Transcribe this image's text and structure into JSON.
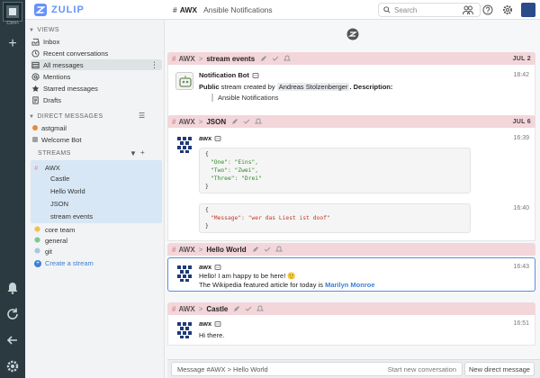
{
  "rail": {
    "hint": "Ctrl+\\"
  },
  "brand": {
    "name": "ZULIP"
  },
  "navbar": {
    "stream": "AWX",
    "description": "Ansible Notifications",
    "search_placeholder": "Search"
  },
  "sidebar": {
    "views_header": "VIEWS",
    "views": [
      {
        "label": "Inbox"
      },
      {
        "label": "Recent conversations"
      },
      {
        "label": "All messages"
      },
      {
        "label": "Mentions"
      },
      {
        "label": "Starred messages"
      },
      {
        "label": "Drafts"
      }
    ],
    "dm_header": "DIRECT MESSAGES",
    "dms": [
      {
        "label": "astgmail"
      },
      {
        "label": "Welcome Bot"
      }
    ],
    "streams_header": "STREAMS",
    "streams": [
      {
        "label": "AWX",
        "color": "#e59aa6"
      },
      {
        "label": "core team",
        "color": "#f5c04a"
      },
      {
        "label": "general",
        "color": "#76ce90"
      },
      {
        "label": "git",
        "color": "#a6c7e5"
      }
    ],
    "topics": [
      {
        "label": "Castle"
      },
      {
        "label": "Hello World"
      },
      {
        "label": "JSON"
      },
      {
        "label": "stream events"
      }
    ],
    "create_stream": "Create a stream"
  },
  "feed": {
    "groups": [
      {
        "stream": "AWX",
        "topic": "stream events",
        "date": "JUL 2",
        "sender": "Notification Bot",
        "time": "18:42",
        "text_prefix": "Public",
        "text_mid": "stream created by",
        "mention": "Andreas Stolzenberger",
        "text_suffix": ". Description:",
        "quote": "Ansible Notifications"
      },
      {
        "stream": "AWX",
        "topic": "JSON",
        "date": "JUL 6",
        "sender": "awx",
        "time1": "16:39",
        "time2": "16:40",
        "code1": [
          "{",
          "\"One\": \"Eins\",",
          "\"Two\": \"Zwei\",",
          "\"Three\": \"Drei\"",
          "}"
        ],
        "code2": [
          "{",
          "\"Message\": \"wer das Liest ist doof\"",
          "}"
        ]
      },
      {
        "stream": "AWX",
        "topic": "Hello World",
        "sender": "awx",
        "time": "16:43",
        "line1": "Hello! I am happy to be here! 🙂",
        "line2_prefix": "The Wikipedia featured article for today is",
        "link": "Marilyn Monroe"
      },
      {
        "stream": "AWX",
        "topic": "Castle",
        "sender": "awx",
        "time": "16:51",
        "line1": "Hi there."
      }
    ]
  },
  "compose": {
    "placeholder": "Message #AWX > Hello World",
    "start_new": "Start new conversation",
    "new_dm": "New direct message"
  },
  "colors": {
    "accent": "#6492fe",
    "recipient_bar": "#f3d6da",
    "link": "#3b7fd4"
  }
}
